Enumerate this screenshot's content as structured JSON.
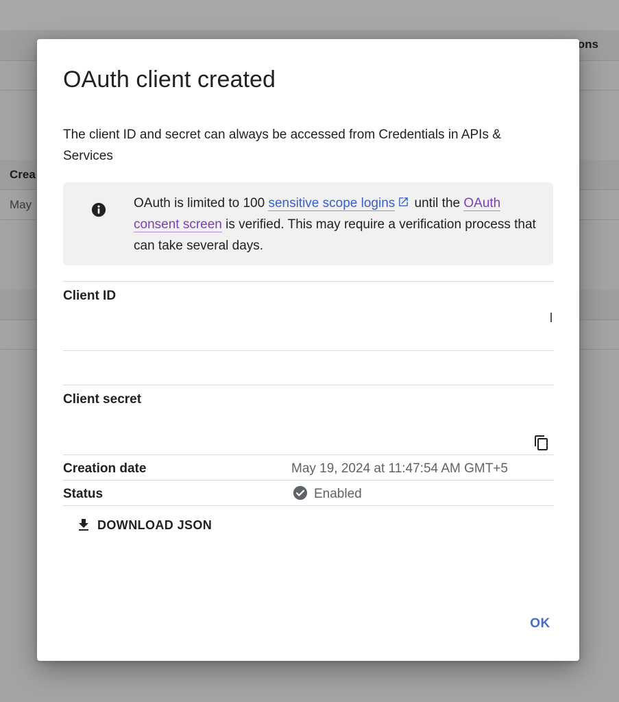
{
  "background": {
    "header_fragment": "ions",
    "column_fragment": "Crea",
    "cell_fragment": "May"
  },
  "dialog": {
    "title": "OAuth client created",
    "intro": "The client ID and secret can always be accessed from Credentials in APIs & Services",
    "notice": {
      "icon": "info-icon",
      "text_before": "OAuth is limited to 100 ",
      "link1": "sensitive scope logins",
      "text_middle": " until the ",
      "link2": "OAuth consent screen",
      "text_after": " is verified. This may require a verification process that can take several days."
    },
    "client_id": {
      "label": "Client ID",
      "value": ""
    },
    "client_secret": {
      "label": "Client secret",
      "value": "",
      "copy_icon": "copy-icon"
    },
    "creation_date": {
      "label": "Creation date",
      "value": "May 19, 2024 at 11:47:54 AM GMT+5"
    },
    "status": {
      "label": "Status",
      "value": "Enabled",
      "icon": "check-circle-icon"
    },
    "download_label": "DOWNLOAD JSON",
    "ok_label": "OK"
  },
  "colors": {
    "link": "#3b5fc9",
    "visited_link": "#7b3fb8",
    "primary_button": "#4a6cc8",
    "notice_bg": "#f1f1f1",
    "scrim": "#a4a4a4"
  }
}
